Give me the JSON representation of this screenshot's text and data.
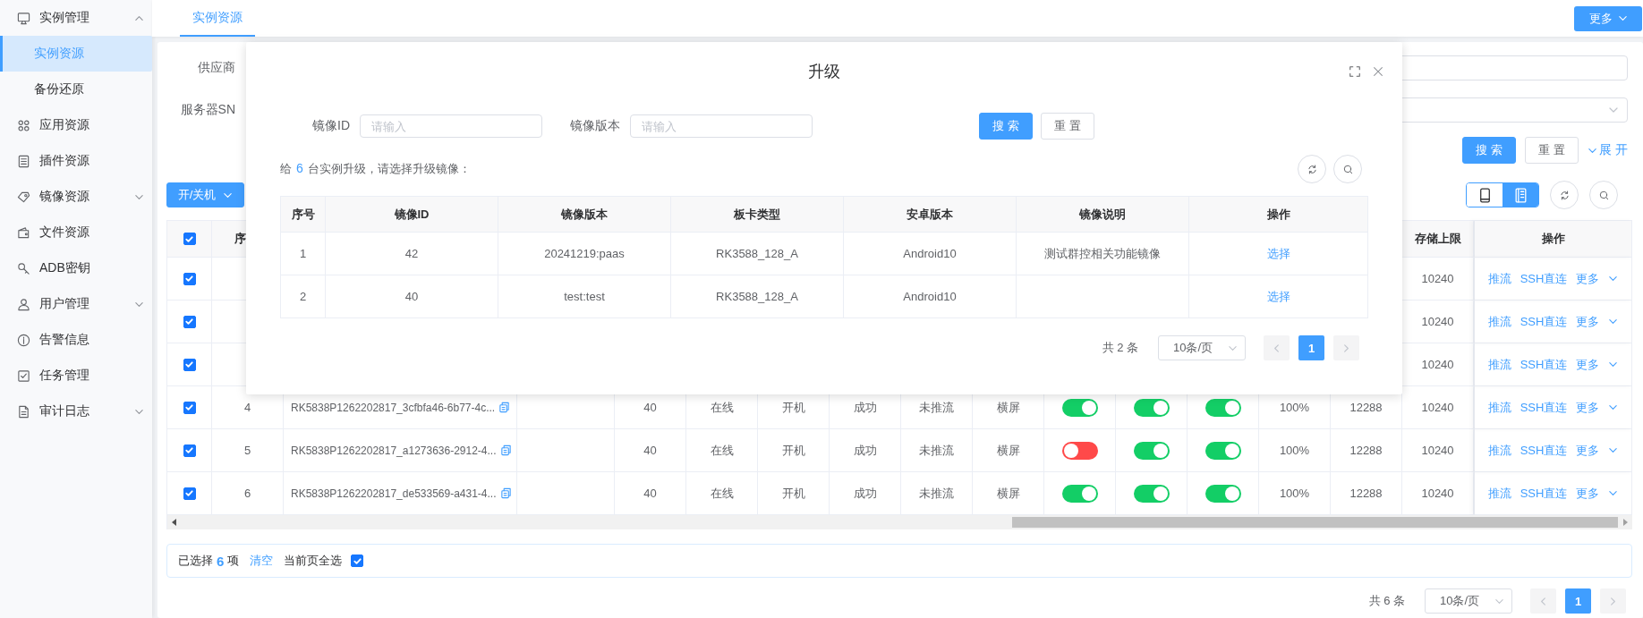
{
  "sidebar": {
    "items": [
      {
        "label": "实例管理",
        "expanded": true,
        "selected": false,
        "children": [
          {
            "label": "实例资源",
            "selected": true
          },
          {
            "label": "备份还原",
            "selected": false
          }
        ]
      },
      {
        "label": "应用资源",
        "selected": false
      },
      {
        "label": "插件资源",
        "selected": false
      },
      {
        "label": "镜像资源",
        "expanded": false,
        "selected": false
      },
      {
        "label": "文件资源",
        "selected": false
      },
      {
        "label": "ADB密钥",
        "selected": false
      },
      {
        "label": "用户管理",
        "expanded": false,
        "selected": false
      },
      {
        "label": "告警信息",
        "selected": false
      },
      {
        "label": "任务管理",
        "selected": false
      },
      {
        "label": "审计日志",
        "expanded": false,
        "selected": false
      }
    ]
  },
  "tabs": [
    {
      "label": "实例资源",
      "selected": true
    }
  ],
  "more_button": "更多",
  "filters": [
    {
      "label": "供应商",
      "kind": "input"
    },
    {
      "label": "服务器SN",
      "kind": "select"
    }
  ],
  "filter_buttons": {
    "search": "搜 索",
    "reset": "重 置",
    "expand": "展 开"
  },
  "power_button": "开/关机",
  "view_toggle": [
    {
      "kind": "phone",
      "selected": false
    },
    {
      "kind": "list",
      "selected": true
    }
  ],
  "table": {
    "header": {
      "checked": true,
      "index": "序",
      "storage_limit": "存储上限",
      "actions": "操作"
    },
    "rows": [
      {
        "checked": true,
        "storage_limit": "10240",
        "actions": [
          "推流",
          "SSH直连",
          "更多"
        ]
      },
      {
        "checked": true,
        "storage_limit": "10240",
        "actions": [
          "推流",
          "SSH直连",
          "更多"
        ]
      },
      {
        "checked": true,
        "storage_limit": "10240",
        "actions": [
          "推流",
          "SSH直连",
          "更多"
        ]
      },
      {
        "checked": true,
        "index": "4",
        "name": "RK5838P1262202817_3cfbfa46-6b77-4c...",
        "column_4": "40",
        "column_5": "在线",
        "column_6": "开机",
        "column_7": "成功",
        "column_8": "未推流",
        "column_9": "横屏",
        "switches": [
          {
            "on": true
          },
          {
            "on": true
          },
          {
            "on": true
          }
        ],
        "column_13": "100%",
        "column_14": "12288",
        "storage_limit": "10240",
        "actions": [
          "推流",
          "SSH直连",
          "更多"
        ]
      },
      {
        "checked": true,
        "index": "5",
        "name": "RK5838P1262202817_a1273636-2912-4...",
        "column_4": "40",
        "column_5": "在线",
        "column_6": "开机",
        "column_7": "成功",
        "column_8": "未推流",
        "column_9": "横屏",
        "switches": [
          {
            "on": false
          },
          {
            "on": true
          },
          {
            "on": true
          }
        ],
        "column_13": "100%",
        "column_14": "12288",
        "storage_limit": "10240",
        "actions": [
          "推流",
          "SSH直连",
          "更多"
        ]
      },
      {
        "checked": true,
        "index": "6",
        "name": "RK5838P1262202817_de533569-a431-4...",
        "column_4": "40",
        "column_5": "在线",
        "column_6": "开机",
        "column_7": "成功",
        "column_8": "未推流",
        "column_9": "横屏",
        "switches": [
          {
            "on": true
          },
          {
            "on": true
          },
          {
            "on": true
          }
        ],
        "column_13": "100%",
        "column_14": "12288",
        "storage_limit": "10240",
        "actions": [
          "推流",
          "SSH直连",
          "更多"
        ]
      }
    ]
  },
  "selection_bar": {
    "prefix": "已选择",
    "count": "6",
    "unit": "项",
    "clear": "清空",
    "page_all_label": "当前页全选",
    "page_all_checked": true
  },
  "pagination": {
    "total": "共 6 条",
    "page_size": "10条/页",
    "pages": [
      {
        "label": "1",
        "selected": true
      }
    ]
  },
  "modal": {
    "title": "升级",
    "fields": [
      {
        "label": "镜像ID",
        "placeholder": "请输入"
      },
      {
        "label": "镜像版本",
        "placeholder": "请输入"
      }
    ],
    "search": "搜 索",
    "reset": "重 置",
    "hint": {
      "before": "给",
      "count": "6",
      "after": "台实例升级，请选择升级镜像："
    },
    "columns": [
      "序号",
      "镜像ID",
      "镜像版本",
      "板卡类型",
      "安卓版本",
      "镜像说明",
      "操作"
    ],
    "rows": [
      {
        "index": "1",
        "image_id": "42",
        "version": "20241219:paas",
        "board": "RK3588_128_A",
        "android": "Android10",
        "description": "测试群控相关功能镜像",
        "action": "选择"
      },
      {
        "index": "2",
        "image_id": "40",
        "version": "test:test",
        "board": "RK3588_128_A",
        "android": "Android10",
        "action": "选择"
      }
    ],
    "pagination": {
      "total": "共 2 条",
      "page_size": "10条/页",
      "pages": [
        {
          "label": "1",
          "selected": true
        }
      ]
    }
  }
}
